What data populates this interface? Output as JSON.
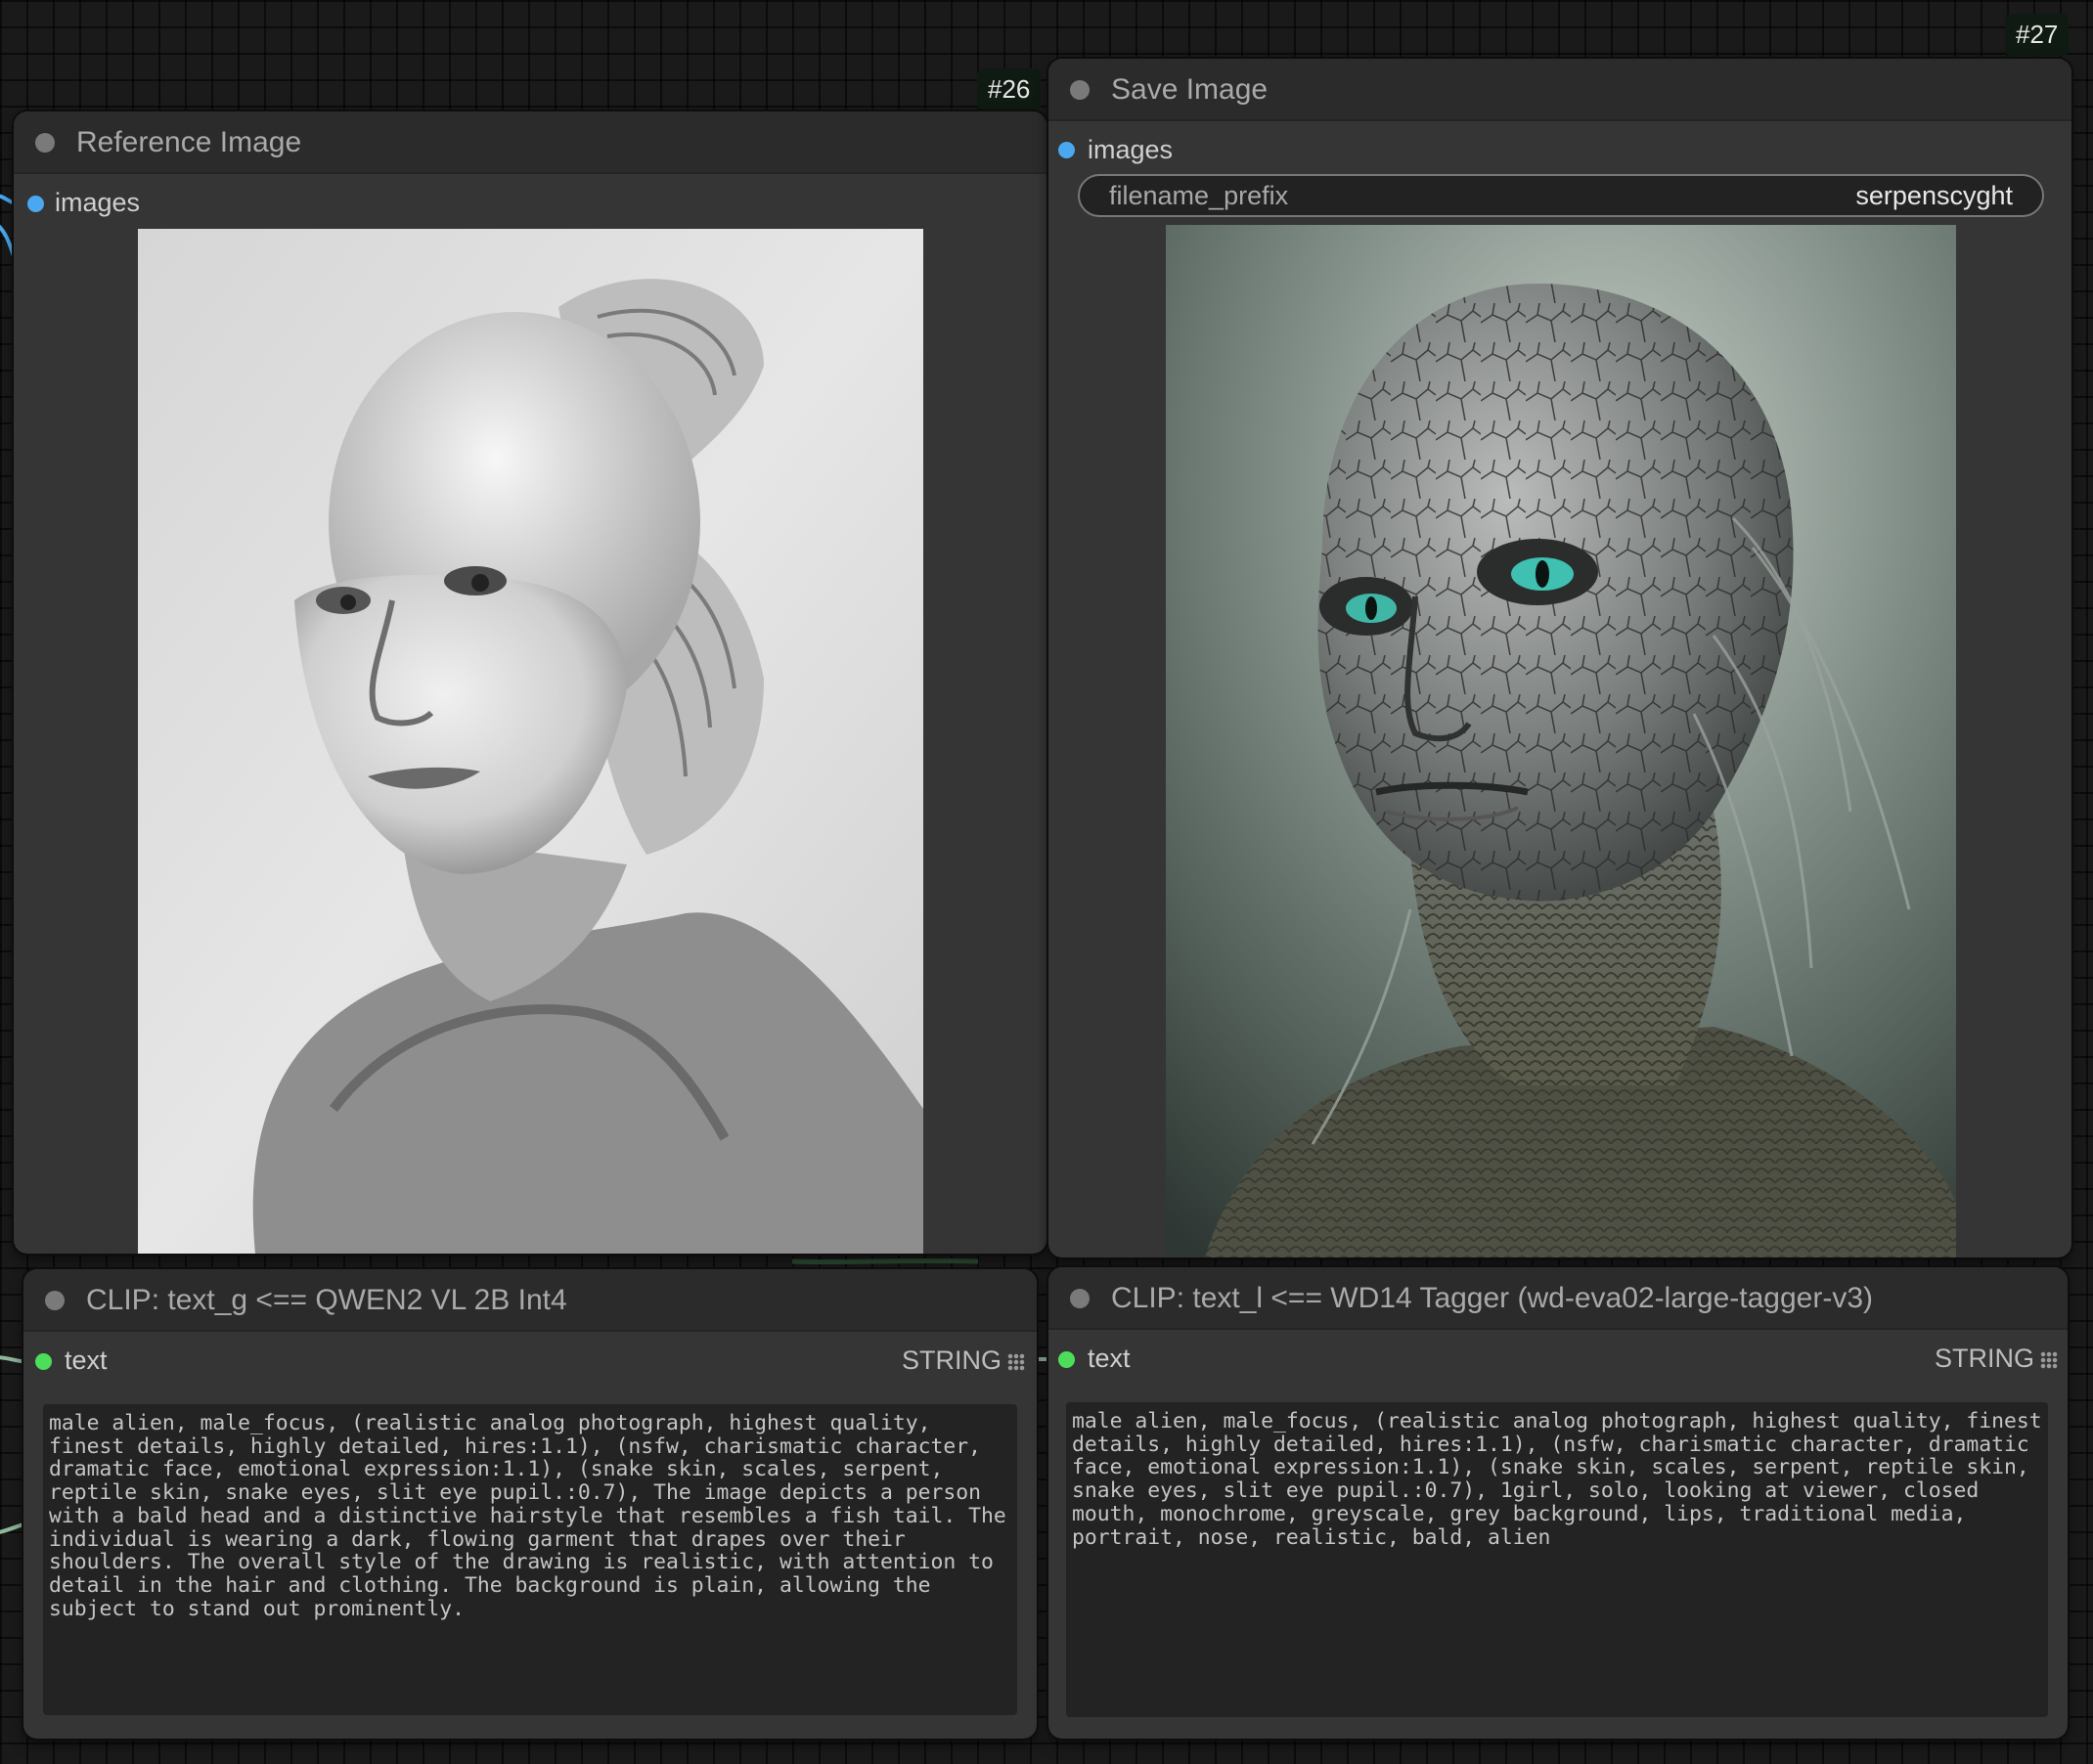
{
  "nodes": {
    "reference": {
      "badge": "#26",
      "title": "Reference Image",
      "input_label": "images",
      "preview": "pencil drawing portrait of bald figure with fish-tail hairstyle"
    },
    "save": {
      "badge": "#27",
      "title": "Save Image",
      "input_label": "images",
      "filename_prefix_label": "filename_prefix",
      "filename_prefix_value": "serpenscyght",
      "preview": "photograph of reptilian alien with snake skin"
    },
    "clip_g": {
      "title": "CLIP: text_g <== QWEN2 VL 2B Int4",
      "output_label": "text",
      "output_type": "STRING",
      "text": "male alien, male_focus, (realistic analog photograph, highest quality, finest details, highly detailed, hires:1.1), (nsfw, charismatic character, dramatic face, emotional expression:1.1), (snake skin, scales, serpent, reptile skin, snake eyes, slit eye pupil.:0.7), The image depicts a person with a bald head and a distinctive hairstyle that resembles a fish tail. The individual is wearing a dark, flowing garment that drapes over their shoulders. The overall style of the drawing is realistic, with attention to detail in the hair and clothing. The background is plain, allowing the subject to stand out prominently."
    },
    "clip_l": {
      "title": "CLIP: text_l <== WD14 Tagger (wd-eva02-large-tagger-v3)",
      "output_label": "text",
      "output_type": "STRING",
      "text": "male alien, male_focus, (realistic analog photograph, highest quality, finest details, highly detailed, hires:1.1), (nsfw, charismatic character, dramatic face, emotional expression:1.1), (snake skin, scales, serpent, reptile skin, snake eyes, slit eye pupil.:0.7), 1girl, solo, looking at viewer, closed mouth, monochrome, greyscale, grey background, lips, traditional media, portrait, nose, realistic, bald, alien"
    }
  },
  "colors": {
    "image_slot": "#4aa8f0",
    "string_slot": "#4cde5a",
    "canvas": "#1a1a1a",
    "node_body": "#353535",
    "node_header": "#2b2b2b"
  }
}
